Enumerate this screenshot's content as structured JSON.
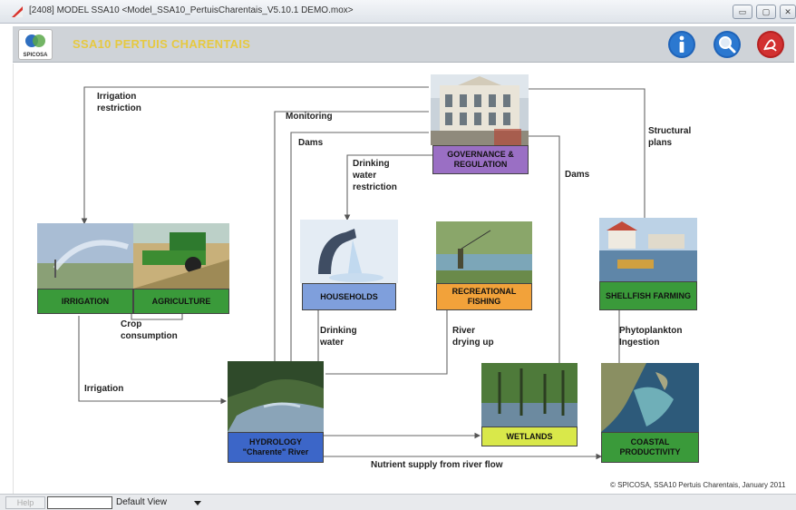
{
  "window": {
    "title": "[2408]  MODEL SSA10   <Model_SSA10_PertuisCharentais_V5.10.1 DEMO.mox>",
    "minimize_glyph": "▭",
    "maximize_glyph": "▢",
    "close_glyph": "✕"
  },
  "banner": {
    "logo_text": "SPICOSA",
    "title": "SSA10 PERTUIS CHARENTAIS",
    "info_icon": "info-icon",
    "search_icon": "magnifier-icon",
    "pdf_icon": "pdf-icon"
  },
  "nodes": {
    "governance": "GOVERNANCE & REGULATION",
    "irrigation": "IRRIGATION",
    "agriculture": "AGRICULTURE",
    "households": "HOUSEHOLDS",
    "recreational_fishing": "RECREATIONAL FISHING",
    "shellfish_farming": "SHELLFISH FARMING",
    "hydrology": "HYDROLOGY \"Charente\" River",
    "wetlands": "WETLANDS",
    "coastal_productivity": "COASTAL PRODUCTIVITY"
  },
  "edge_labels": {
    "irrigation_restriction": "Irrigation\nrestriction",
    "monitoring": "Monitoring",
    "dams_left": "Dams",
    "drinking_water_restriction": "Drinking\nwater\nrestriction",
    "dams_right": "Dams",
    "structural_plans": "Structural\nplans",
    "crop_consumption": "Crop\nconsumption",
    "drinking_water": "Drinking\nwater",
    "river_drying_up": "River\ndrying up",
    "phytoplankton_ingestion": "Phytoplankton\nIngestion",
    "irrigation": "Irrigation",
    "nutrient_supply": "Nutrient supply from river flow"
  },
  "copyright": "© SPICOSA, SSA10 Pertuis Charentais, January 2011",
  "statusbar": {
    "help_label": "Help",
    "field_value": "",
    "view_value": "Default View"
  },
  "colors": {
    "governance": "#9a6fc4",
    "green_label": "#3a9a3a",
    "households": "#7f9fdc",
    "recreational_fishing": "#f2a23a",
    "hydrology": "#3c66c8",
    "wetlands": "#d9e84a",
    "banner_title": "#e6c940"
  }
}
